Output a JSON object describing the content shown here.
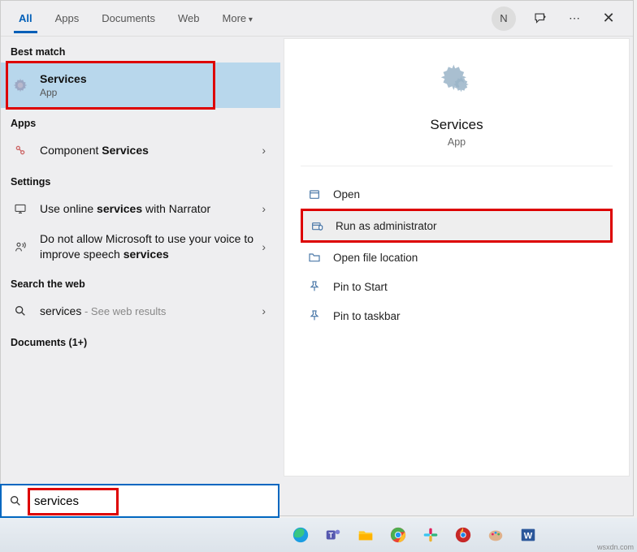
{
  "tabs": {
    "items": [
      "All",
      "Apps",
      "Documents",
      "Web",
      "More"
    ],
    "avatar_initial": "N"
  },
  "left": {
    "best_match_hdr": "Best match",
    "best_match": {
      "title": "Services",
      "sub": "App"
    },
    "apps_hdr": "Apps",
    "apps": [
      {
        "prefix": "Component ",
        "bold": "Services"
      }
    ],
    "settings_hdr": "Settings",
    "settings": [
      {
        "prefix": "Use online ",
        "bold": "services",
        "suffix": " with Narrator"
      },
      {
        "prefix": "Do not allow Microsoft to use your voice to improve speech ",
        "bold": "services",
        "suffix": ""
      }
    ],
    "web_hdr": "Search the web",
    "web": {
      "term": "services",
      "hint": " - See web results"
    },
    "docs_hdr": "Documents (1+)"
  },
  "hero": {
    "title": "Services",
    "sub": "App"
  },
  "actions": {
    "open": "Open",
    "run_admin": "Run as administrator",
    "open_loc": "Open file location",
    "pin_start": "Pin to Start",
    "pin_taskbar": "Pin to taskbar"
  },
  "search": {
    "value": "services"
  },
  "watermark": "wsxdn.com"
}
